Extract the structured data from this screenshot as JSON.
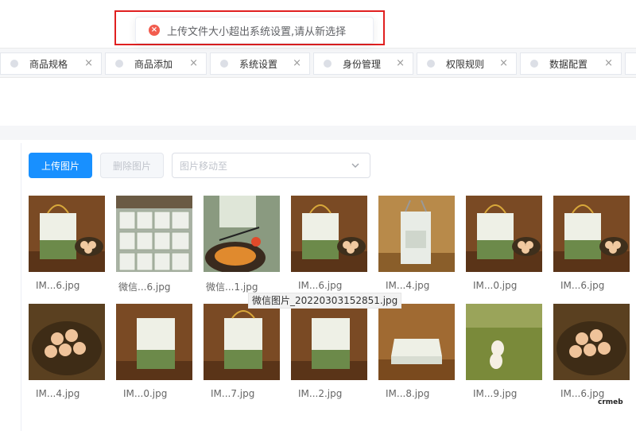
{
  "toast": {
    "message": "上传文件大小超出系统设置,请从新选择"
  },
  "tabs": [
    {
      "label": "商品规格"
    },
    {
      "label": "商品添加"
    },
    {
      "label": "系统设置"
    },
    {
      "label": "身份管理"
    },
    {
      "label": "权限规则"
    },
    {
      "label": "数据配置"
    }
  ],
  "toolbar": {
    "upload_label": "上传图片",
    "delete_label": "删除图片",
    "move_placeholder": "图片移动至"
  },
  "images": [
    {
      "name": "IM...6.jpg",
      "icon": "egg-gift-box-image"
    },
    {
      "name": "微信...6.jpg",
      "icon": "stacked-boxes-image"
    },
    {
      "name": "微信...1.jpg",
      "icon": "cooking-egg-image"
    },
    {
      "name": "IM...6.jpg",
      "icon": "egg-gift-box-image"
    },
    {
      "name": "IM...4.jpg",
      "icon": "box-back-image"
    },
    {
      "name": "IM...0.jpg",
      "icon": "egg-gift-box-image"
    },
    {
      "name": "IM...6.jpg",
      "icon": "egg-gift-box-image"
    },
    {
      "name": "IM...4.jpg",
      "icon": "eggs-in-nest-image"
    },
    {
      "name": "IM...0.jpg",
      "icon": "gift-box-image"
    },
    {
      "name": "IM...7.jpg",
      "icon": "gift-box-image"
    },
    {
      "name": "IM...2.jpg",
      "icon": "gift-box-image"
    },
    {
      "name": "IM...8.jpg",
      "icon": "box-top-image"
    },
    {
      "name": "IM...9.jpg",
      "icon": "eggs-on-grass-image"
    },
    {
      "name": "IM...6.jpg",
      "icon": "eggs-in-nest-image"
    }
  ],
  "tooltip": {
    "text": "微信图片_20220303152851.jpg"
  },
  "brand": {
    "logo": "crmeb"
  }
}
